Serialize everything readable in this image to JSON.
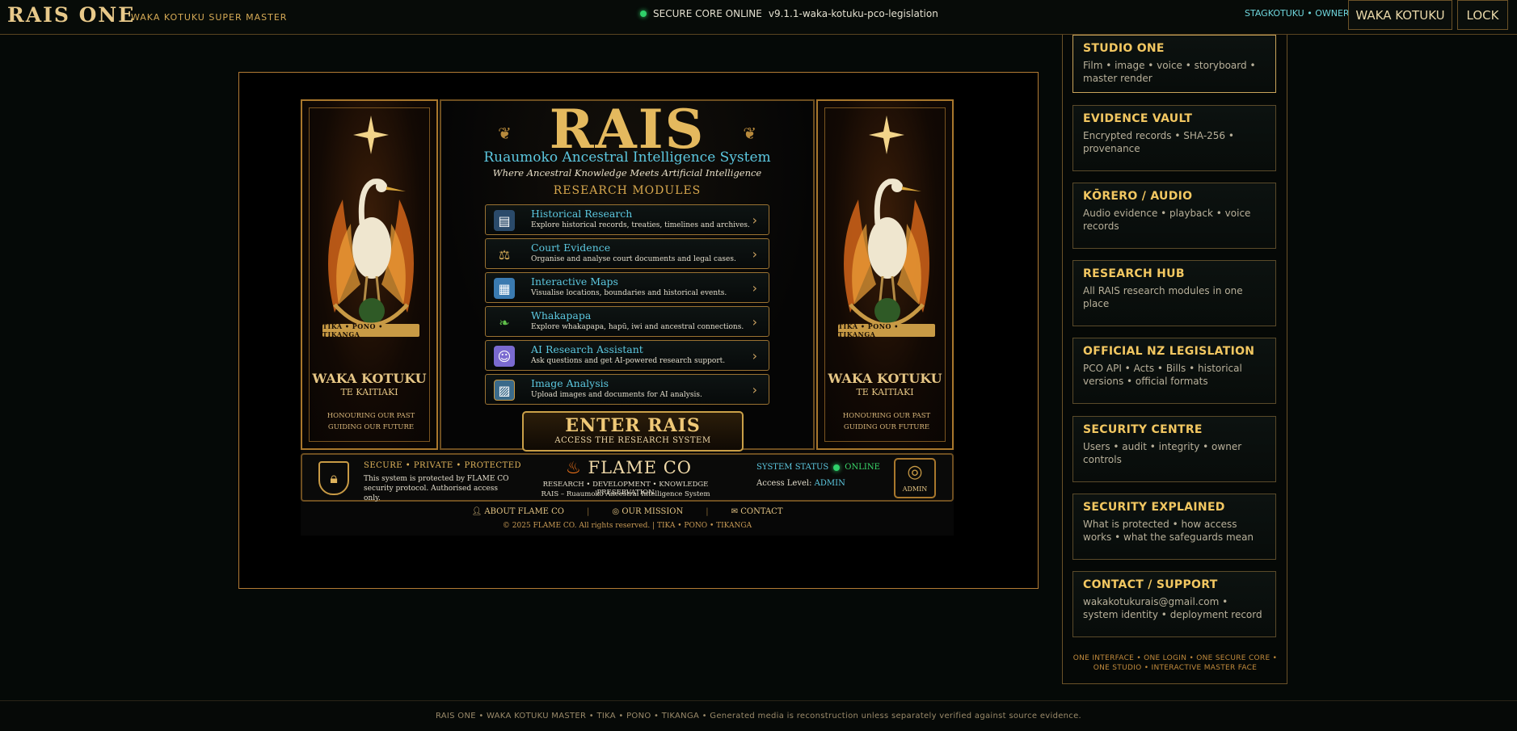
{
  "topbar": {
    "brand": "RAIS ONE",
    "brand_sub": "WAKA KOTUKU SUPER MASTER",
    "core_status": "SECURE CORE ONLINE",
    "version": "v9.1.1-waka-kotuku-pco-legislation",
    "owner_label": "STAGKOTUKU • OWNER",
    "user_button": "WAKA KOTUKU",
    "lock_button": "LOCK"
  },
  "poster": {
    "title": "RAIS",
    "subtitle": "Ruaumoko Ancestral Intelligence System",
    "tagline": "Where Ancestral Knowledge Meets Artificial Intelligence",
    "modules_heading": "RESEARCH MODULES",
    "modules": [
      {
        "name": "Historical Research",
        "desc": "Explore historical records, treaties, timelines and archives.",
        "icon": "books-icon"
      },
      {
        "name": "Court Evidence",
        "desc": "Organise and analyse court documents and legal cases.",
        "icon": "scales-icon"
      },
      {
        "name": "Interactive Maps",
        "desc": "Visualise locations, boundaries and historical events.",
        "icon": "map-icon"
      },
      {
        "name": "Whakapapa",
        "desc": "Explore whakapapa, hapū, iwi and ancestral connections.",
        "icon": "fern-icon"
      },
      {
        "name": "AI Research Assistant",
        "desc": "Ask questions and get AI-powered research support.",
        "icon": "robot-icon"
      },
      {
        "name": "Image Analysis",
        "desc": "Upload images and documents for AI analysis.",
        "icon": "image-icon"
      }
    ],
    "enter_title": "ENTER RAIS",
    "enter_sub": "ACCESS THE RESEARCH SYSTEM",
    "left_panel": {
      "ribbon": "TIKA • PONO • TIKANGA",
      "title": "WAKA KOTUKU",
      "subtitle": "TE KAITIAKI",
      "foot_1": "HONOURING OUR PAST",
      "foot_2": "GUIDING OUR FUTURE"
    },
    "right_panel": {
      "ribbon": "TIKA • PONO • TIKANGA",
      "title": "WAKA KOTUKU",
      "subtitle": "TE KAITIAKI",
      "foot_1": "HONOURING OUR PAST",
      "foot_2": "GUIDING OUR FUTURE"
    },
    "footer": {
      "secure_head": "SECURE  •  PRIVATE  •  PROTECTED",
      "secure_body": "This system is protected by FLAME CO security protocol. Authorised access only.",
      "flame_name": "FLAME CO",
      "flame_sub1": "RESEARCH  •  DEVELOPMENT  •  KNOWLEDGE PRESERVATION",
      "flame_sub2": "RAIS – Ruaumoko Ancestral Intelligence System",
      "system_status_label": "SYSTEM STATUS",
      "system_status_value": "ONLINE",
      "access_label": "Access Level:",
      "access_value": "ADMIN",
      "admin_badge": "ADMIN"
    },
    "links": {
      "about": "ABOUT FLAME CO",
      "mission": "OUR MISSION",
      "contact": "CONTACT"
    },
    "copyright": "© 2025 FLAME CO. All rights reserved.     |     TIKA  •  PONO  •  TIKANGA"
  },
  "sidebar": {
    "cards": [
      {
        "title": "STUDIO ONE",
        "desc": "Film • image • voice • storyboard • master render",
        "active": true
      },
      {
        "title": "EVIDENCE VAULT",
        "desc": "Encrypted records • SHA-256 • provenance"
      },
      {
        "title": "KŌRERO / AUDIO",
        "desc": "Audio evidence • playback • voice records"
      },
      {
        "title": "RESEARCH HUB",
        "desc": "All RAIS research modules in one place"
      },
      {
        "title": "OFFICIAL NZ LEGISLATION",
        "desc": "PCO API • Acts • Bills • historical versions • official formats"
      },
      {
        "title": "SECURITY CENTRE",
        "desc": "Users • audit • integrity • owner controls"
      },
      {
        "title": "SECURITY EXPLAINED",
        "desc": "What is protected • how access works • what the safeguards mean"
      },
      {
        "title": "CONTACT / SUPPORT",
        "desc": "wakakotukurais@gmail.com • system identity • deployment record"
      }
    ],
    "footer": "ONE INTERFACE • ONE LOGIN • ONE SECURE CORE • ONE STUDIO • INTERACTIVE MASTER FACE"
  },
  "bottombar": {
    "text": "RAIS ONE • WAKA KOTUKU MASTER • TIKA • PONO • TIKANGA • Generated media is reconstruction unless separately verified against source evidence."
  },
  "colors": {
    "gold": "#e4b95e",
    "cyan": "#5cc8e0",
    "card_title": "#f2c761",
    "online_green": "#2fd06a",
    "frame_border": "#b27a34"
  }
}
